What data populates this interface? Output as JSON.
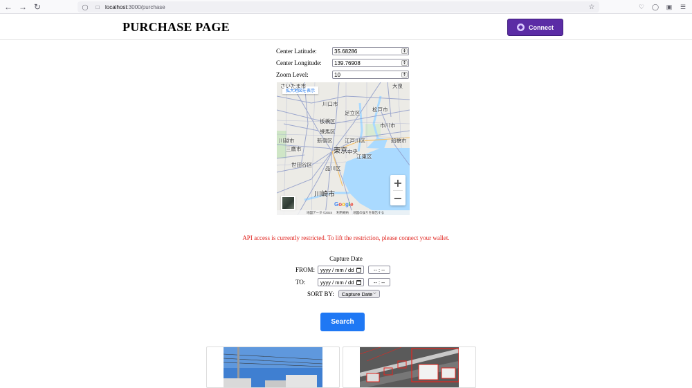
{
  "browser": {
    "url_host": "localhost",
    "url_path": ":3000/purchase",
    "icons": [
      "back-icon",
      "forward-icon",
      "reload-icon",
      "shield-icon",
      "page-icon",
      "star-icon",
      "pocket-icon",
      "account-icon",
      "extensions-icon",
      "menu-icon"
    ]
  },
  "header": {
    "title": "PURCHASE PAGE",
    "connect_label": "Connect"
  },
  "map_form": {
    "latitude_label": "Center Latitude:",
    "latitude_value": "35.68286",
    "longitude_label": "Center Longitude:",
    "longitude_value": "139.76908",
    "zoom_label": "Zoom Level:",
    "zoom_value": "10"
  },
  "map": {
    "enlarge_link": "拡大地図を表示",
    "labels": [
      "さいたま市",
      "川口市",
      "足立区",
      "松戸市",
      "板橋区",
      "市川市",
      "新宿区",
      "江戸川区",
      "船橋市",
      "東京",
      "江東区",
      "世田谷区",
      "品川区",
      "川崎市",
      "川越市",
      "三鷹市",
      "練馬区",
      "中央",
      "大泉"
    ],
    "footer": [
      "地図データ ©2024",
      "利用規約",
      "地図の誤りを報告する"
    ],
    "google_logo": "Google",
    "colors": {
      "water": "#aadaff",
      "land": "#e8e6e1",
      "road": "#8e9bc9"
    }
  },
  "warning": "API access is currently restricted. To lift the restriction, please connect your wallet.",
  "capture": {
    "title": "Capture Date",
    "from_label": "FROM:",
    "to_label": "TO:",
    "date_placeholder": "yyyy / mm / dd",
    "time_placeholder": "-- : --",
    "sort_label": "SORT BY:",
    "sort_value": "Capture Date",
    "search_label": "Search"
  },
  "colors": {
    "accent_purple": "#5b2ca5",
    "search_blue": "#1f78f4",
    "warning_red": "#e0201b"
  }
}
